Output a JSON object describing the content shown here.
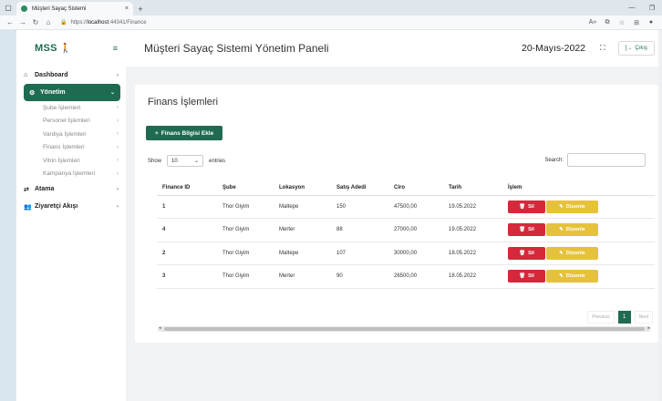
{
  "browser": {
    "tab_title": "Müşteri Sayaç Sistemi",
    "tab_close": "×",
    "new_tab": "+",
    "url_prefix": "https://",
    "url_host": "localhost",
    "url_path": ":44341/Finance"
  },
  "sidebar": {
    "logo": "MSS",
    "items": [
      {
        "label": "Dashboard",
        "icon": "home-icon"
      },
      {
        "label": "Yönetim",
        "icon": "gear-icon",
        "active": true
      },
      {
        "label": "Atama",
        "icon": "swap-icon"
      },
      {
        "label": "Ziyaretçi Akışı",
        "icon": "users-icon"
      }
    ],
    "subitems": [
      "Şube İşlemleri",
      "Personel İşlemleri",
      "Vardiya İşlemleri",
      "Finans İşlemleri",
      "Vitrin İşlemleri",
      "Kampanya İşlemleri"
    ]
  },
  "header": {
    "title": "Müşteri Sayaç Sistemi Yönetim Paneli",
    "date": "20-Mayıs-2022",
    "logout": "Çıkış"
  },
  "main": {
    "card_title": "Finans İşlemleri",
    "add_button": "Finans Bilgisi Ekle",
    "show_label": "Show",
    "show_value": "10",
    "entries_label": "entries",
    "search_label": "Search:",
    "columns": [
      "Finance ID",
      "Şube",
      "Lokasyon",
      "Satış Adedi",
      "Ciro",
      "Tarih",
      "İşlem"
    ],
    "rows": [
      {
        "id": "1",
        "sube": "Thor Giyim",
        "lokasyon": "Maltepe",
        "satis": "150",
        "ciro": "47500,00",
        "tarih": "19.05.2022"
      },
      {
        "id": "4",
        "sube": "Thor Giyim",
        "lokasyon": "Merter",
        "satis": "88",
        "ciro": "27000,00",
        "tarih": "19.05.2022"
      },
      {
        "id": "2",
        "sube": "Thor Giyim",
        "lokasyon": "Maltepe",
        "satis": "107",
        "ciro": "30000,00",
        "tarih": "18.05.2022"
      },
      {
        "id": "3",
        "sube": "Thor Giyim",
        "lokasyon": "Merter",
        "satis": "90",
        "ciro": "26500,00",
        "tarih": "18.05.2022"
      }
    ],
    "delete_label": "Sil",
    "edit_label": "Düzenle",
    "pager": {
      "previous": "Previous",
      "current": "1",
      "next": "Next"
    }
  },
  "colors": {
    "brand": "#1f6b52",
    "danger": "#d6283b",
    "warning": "#e6c23a"
  }
}
